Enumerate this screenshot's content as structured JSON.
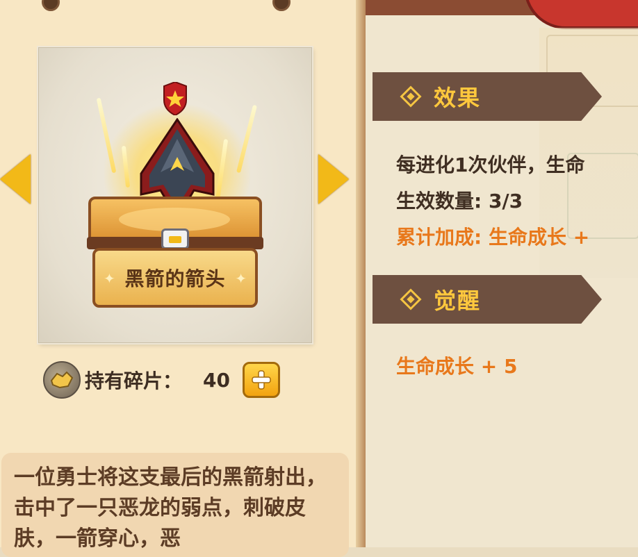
{
  "item": {
    "name": "黑箭的箭头",
    "shards_label": "持有碎片：",
    "shards_count": "40",
    "description": "一位勇士将这支最后的黑箭射出，击中了一只恶龙的弱点，刺破皮肤，一箭穿心，恶"
  },
  "sections": {
    "effect": {
      "title": "效果",
      "lines": [
        "每进化1次伙伴，生命",
        "生效数量: 3/3",
        "累计加成: 生命成长 +"
      ]
    },
    "awaken": {
      "title": "觉醒",
      "lines": [
        "生命成长 + 5"
      ]
    }
  },
  "colors": {
    "accent": "#f2b918",
    "header_bg": "#6e5040",
    "header_text": "#ffc83d",
    "highlight_text": "#e8781b",
    "body_text": "#3f2e22"
  },
  "icons": [
    "star-badge-icon",
    "arrowhead-icon",
    "shard-icon",
    "plus-icon",
    "arrow-left-icon",
    "arrow-right-icon",
    "diamond-bullet-icon"
  ]
}
